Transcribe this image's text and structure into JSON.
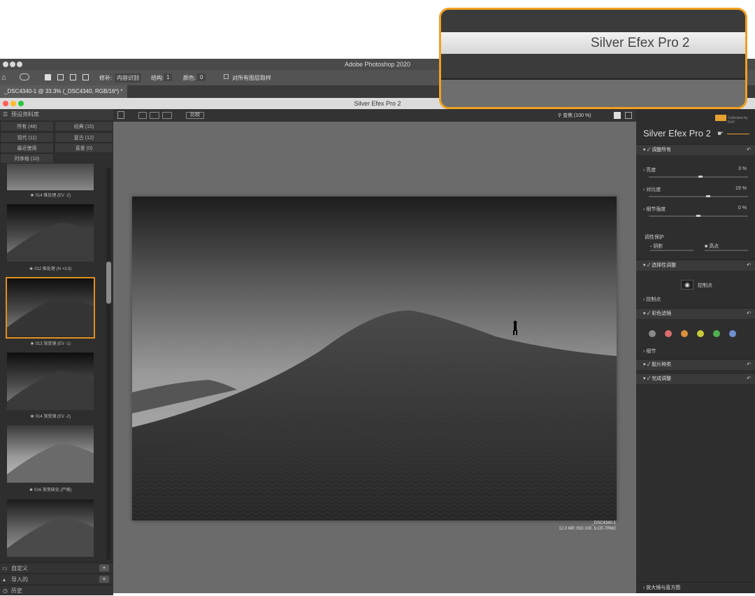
{
  "photoshop": {
    "app_title": "Adobe Photoshop 2020",
    "options": {
      "repair_label": "修补:",
      "repair_value": "内容识别",
      "structure_label": "结构:",
      "structure_value": "1",
      "color_label": "颜色:",
      "color_value": "0",
      "sample_all_label": "对所有图层取样"
    },
    "doc_tab": "_DSC4340-1 @ 33.3% (_DSC4340, RGB/16*) *"
  },
  "plugin": {
    "window_title": "Silver Efex Pro 2",
    "callout_title": "Silver Efex Pro 2",
    "left_panel": {
      "header": "预设资料库",
      "categories": [
        {
          "label": "所有 (48)"
        },
        {
          "label": "经典 (15)"
        },
        {
          "label": "现代 (11)"
        },
        {
          "label": "复古 (12)"
        },
        {
          "label": "最近使用"
        },
        {
          "label": "喜爱 (0)"
        },
        {
          "label": "时序格 (10)"
        }
      ],
      "thumbnails": [
        {
          "caption": "★ 014 推处理 (EV -2)"
        },
        {
          "caption": "★ 012 推处理 (N +3.9)"
        },
        {
          "caption": "★ 013 渐变镜 (EV -1)"
        },
        {
          "caption": "★ 014 渐变镜 (EV -2)"
        },
        {
          "caption": "★ 016 渐变硫化 (严格)"
        },
        {
          "caption": ""
        }
      ],
      "bottom": [
        {
          "label": "自定义",
          "button": "+"
        },
        {
          "label": "导入的",
          "button": "+"
        },
        {
          "label": "历史",
          "button": ""
        }
      ]
    },
    "center": {
      "compare_label": "比较",
      "zoom_label": "变焦 (100 %)",
      "image_caption_name": "_DSC4340-1",
      "image_caption_info": "12.0 MP, ISO 100, ILCE-7RM2"
    },
    "right_panel": {
      "brand": "Silver Efex Pro",
      "brand_num": "2",
      "brand_small": "Collection by DxO",
      "global_section": "调整所有",
      "sliders": [
        {
          "label": "亮度",
          "value": "3 %",
          "level": 0.52
        },
        {
          "label": "对比度",
          "value": "19 %",
          "level": 0.6
        },
        {
          "label": "细节强度",
          "value": "0 %",
          "level": 0.5
        }
      ],
      "tonality_label": "调性保护",
      "shadows_label": "阴影",
      "highlights_label": "高点",
      "selective_section": "选择性调整",
      "control_point_button": "控制点",
      "control_point_row": "控制点",
      "color_filter_section": "彩色滤镜",
      "filter_colors": [
        "#8a8a8a",
        "#d96c6c",
        "#d9913c",
        "#c9c83a",
        "#4fb04f",
        "#6f8fd0"
      ],
      "details_label": "细节",
      "film_section": "胶片种类",
      "finish_section": "完成调整",
      "loupe_section": "放大镜与直方图"
    }
  }
}
